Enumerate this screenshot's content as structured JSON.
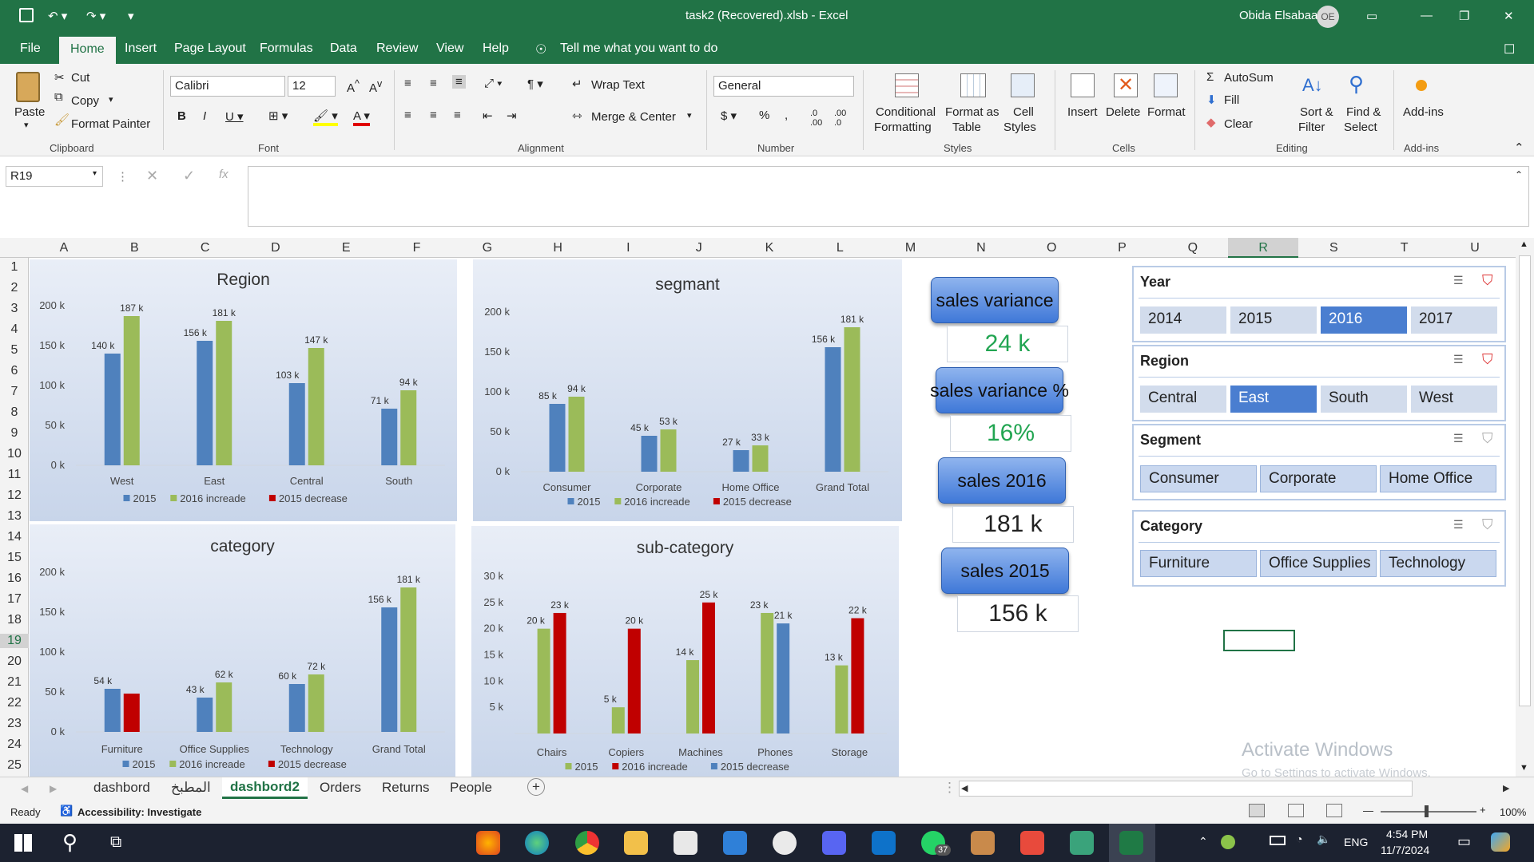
{
  "window": {
    "title": "task2 (Recovered).xlsb  -  Excel",
    "user": "Obida Elsabaa",
    "user_initials": "OE"
  },
  "menu": {
    "tabs": [
      "File",
      "Home",
      "Insert",
      "Page Layout",
      "Formulas",
      "Data",
      "Review",
      "View",
      "Help"
    ],
    "tell_me": "Tell me what you want to do"
  },
  "ribbon": {
    "clipboard": {
      "paste": "Paste",
      "cut": "Cut",
      "copy": "Copy",
      "format_painter": "Format Painter",
      "group": "Clipboard"
    },
    "font": {
      "name": "Calibri",
      "size": "12",
      "group": "Font"
    },
    "alignment": {
      "wrap": "Wrap Text",
      "merge": "Merge & Center",
      "group": "Alignment"
    },
    "number": {
      "format": "General",
      "group": "Number"
    },
    "styles": {
      "conditional": "Conditional",
      "conditional2": "Formatting",
      "format_as": "Format as",
      "format_as2": "Table",
      "cell": "Cell",
      "cell2": "Styles",
      "group": "Styles"
    },
    "cells": {
      "insert": "Insert",
      "delete": "Delete",
      "format": "Format",
      "group": "Cells"
    },
    "editing": {
      "autosum": "AutoSum",
      "fill": "Fill",
      "clear": "Clear",
      "sort": "Sort &",
      "sort2": "Filter",
      "find": "Find &",
      "find2": "Select",
      "group": "Editing"
    },
    "addins": {
      "label": "Add-ins",
      "group": "Add-ins"
    }
  },
  "formula_bar": {
    "name_box": "R19",
    "value": ""
  },
  "columns": [
    "A",
    "B",
    "C",
    "D",
    "E",
    "F",
    "G",
    "H",
    "I",
    "J",
    "K",
    "L",
    "M",
    "N",
    "O",
    "P",
    "Q",
    "R",
    "S",
    "T",
    "U"
  ],
  "rows": [
    "1",
    "2",
    "3",
    "4",
    "5",
    "6",
    "7",
    "8",
    "9",
    "10",
    "11",
    "12",
    "13",
    "14",
    "15",
    "16",
    "17",
    "18",
    "19",
    "20",
    "21",
    "22",
    "23",
    "24",
    "25"
  ],
  "chart_data": [
    {
      "type": "bar",
      "title": "Region",
      "categories": [
        "West",
        "East",
        "Central",
        "South"
      ],
      "series": [
        {
          "name": "2015",
          "values": [
            140,
            156,
            103,
            71
          ]
        },
        {
          "name": "2016 increade",
          "values": [
            187,
            181,
            147,
            94
          ]
        },
        {
          "name": "2015 decrease",
          "values": [
            0,
            0,
            0,
            0
          ]
        }
      ],
      "data_labels": [
        [
          "140 k",
          "156 k",
          "103 k",
          "71 k"
        ],
        [
          "187 k",
          "181 k",
          "147 k",
          "94 k"
        ]
      ],
      "ylim": [
        0,
        200
      ],
      "yticks": [
        "0 k",
        "50 k",
        "100 k",
        "150 k",
        "200 k"
      ],
      "colors": [
        "#4f81bd",
        "#9bbb59",
        "#c00000"
      ]
    },
    {
      "type": "bar",
      "title": "segmant",
      "categories": [
        "Consumer",
        "Corporate",
        "Home Office",
        "Grand Total"
      ],
      "series": [
        {
          "name": "2015",
          "values": [
            85,
            45,
            27,
            156
          ]
        },
        {
          "name": "2016 increade",
          "values": [
            94,
            53,
            33,
            181
          ]
        },
        {
          "name": "2015 decrease",
          "values": [
            0,
            0,
            0,
            0
          ]
        }
      ],
      "data_labels": [
        [
          "85 k",
          "45 k",
          "27 k",
          "156 k"
        ],
        [
          "94 k",
          "53 k",
          "33 k",
          "181 k"
        ]
      ],
      "ylim": [
        0,
        200
      ],
      "yticks": [
        "0 k",
        "50 k",
        "100 k",
        "150 k",
        "200 k"
      ],
      "colors": [
        "#4f81bd",
        "#9bbb59",
        "#c00000"
      ]
    },
    {
      "type": "bar",
      "title": "category",
      "categories": [
        "Furniture",
        "Office Supplies",
        "Technology",
        "Grand Total"
      ],
      "series": [
        {
          "name": "2015",
          "values": [
            54,
            43,
            60,
            156
          ]
        },
        {
          "name": "2016 increade",
          "values": [
            0,
            62,
            72,
            181
          ]
        },
        {
          "name": "2015 decrease",
          "values": [
            48,
            0,
            0,
            0
          ]
        }
      ],
      "data_labels": [
        [
          "54 k",
          "43 k",
          "60 k",
          "156 k"
        ],
        [
          "",
          "62 k",
          "72 k",
          "181 k"
        ],
        [
          "",
          "",
          "",
          ""
        ]
      ],
      "ylim": [
        0,
        200
      ],
      "yticks": [
        "0 k",
        "50 k",
        "100 k",
        "150 k",
        "200 k"
      ],
      "colors": [
        "#4f81bd",
        "#9bbb59",
        "#c00000"
      ]
    },
    {
      "type": "bar",
      "title": "sub-category",
      "categories": [
        "Chairs",
        "Copiers",
        "Machines",
        "Phones",
        "Storage"
      ],
      "series": [
        {
          "name": "2015",
          "values": [
            20,
            5,
            14,
            23,
            13
          ]
        },
        {
          "name": "2016 increade",
          "values": [
            23,
            20,
            25,
            0,
            22
          ]
        },
        {
          "name": "2015 decrease",
          "values": [
            0,
            0,
            0,
            21,
            0
          ]
        }
      ],
      "data_labels": [
        [
          "20 k",
          "5 k",
          "14 k",
          "23 k",
          "13 k"
        ],
        [
          "23 k",
          "20 k",
          "25 k",
          "",
          "22 k"
        ],
        [
          "",
          "",
          "",
          "21 k",
          ""
        ]
      ],
      "ylim": [
        0,
        30
      ],
      "yticks": [
        "",
        "5 k",
        "10 k",
        "15 k",
        "20 k",
        "25 k",
        "30 k"
      ],
      "colors": [
        "#9bbb59",
        "#c00000",
        "#4f81bd"
      ]
    }
  ],
  "kpis": [
    {
      "label": "sales variance",
      "value": "24 k",
      "color": "#22a552"
    },
    {
      "label": "sales variance %",
      "value": "16%",
      "color": "#22a552"
    },
    {
      "label": "sales 2016",
      "value": "181 k",
      "color": "#111111"
    },
    {
      "label": "sales 2015",
      "value": "156 k",
      "color": "#111111"
    }
  ],
  "slicers": {
    "year": {
      "title": "Year",
      "items": [
        "2014",
        "2015",
        "2016",
        "2017"
      ],
      "selected": "2016"
    },
    "region": {
      "title": "Region",
      "items": [
        "Central",
        "East",
        "South",
        "West"
      ],
      "selected": "East"
    },
    "segment": {
      "title": "Segment",
      "items": [
        "Consumer",
        "Corporate",
        "Home Office"
      ]
    },
    "category": {
      "title": "Category",
      "items": [
        "Furniture",
        "Office Supplies",
        "Technology"
      ]
    }
  },
  "watermark": {
    "line1": "Activate Windows",
    "line2": "Go to Settings to activate Windows."
  },
  "sheet_tabs": [
    "dashbord",
    "المطبخ",
    "dashbord2",
    "Orders",
    "Returns",
    "People"
  ],
  "active_tab": "dashbord2",
  "status": {
    "ready": "Ready",
    "accessibility": "Accessibility: Investigate",
    "zoom": "100%"
  },
  "taskbar": {
    "time": "4:54 PM",
    "date": "11/7/2024",
    "lang": "ENG",
    "badge": "37"
  }
}
